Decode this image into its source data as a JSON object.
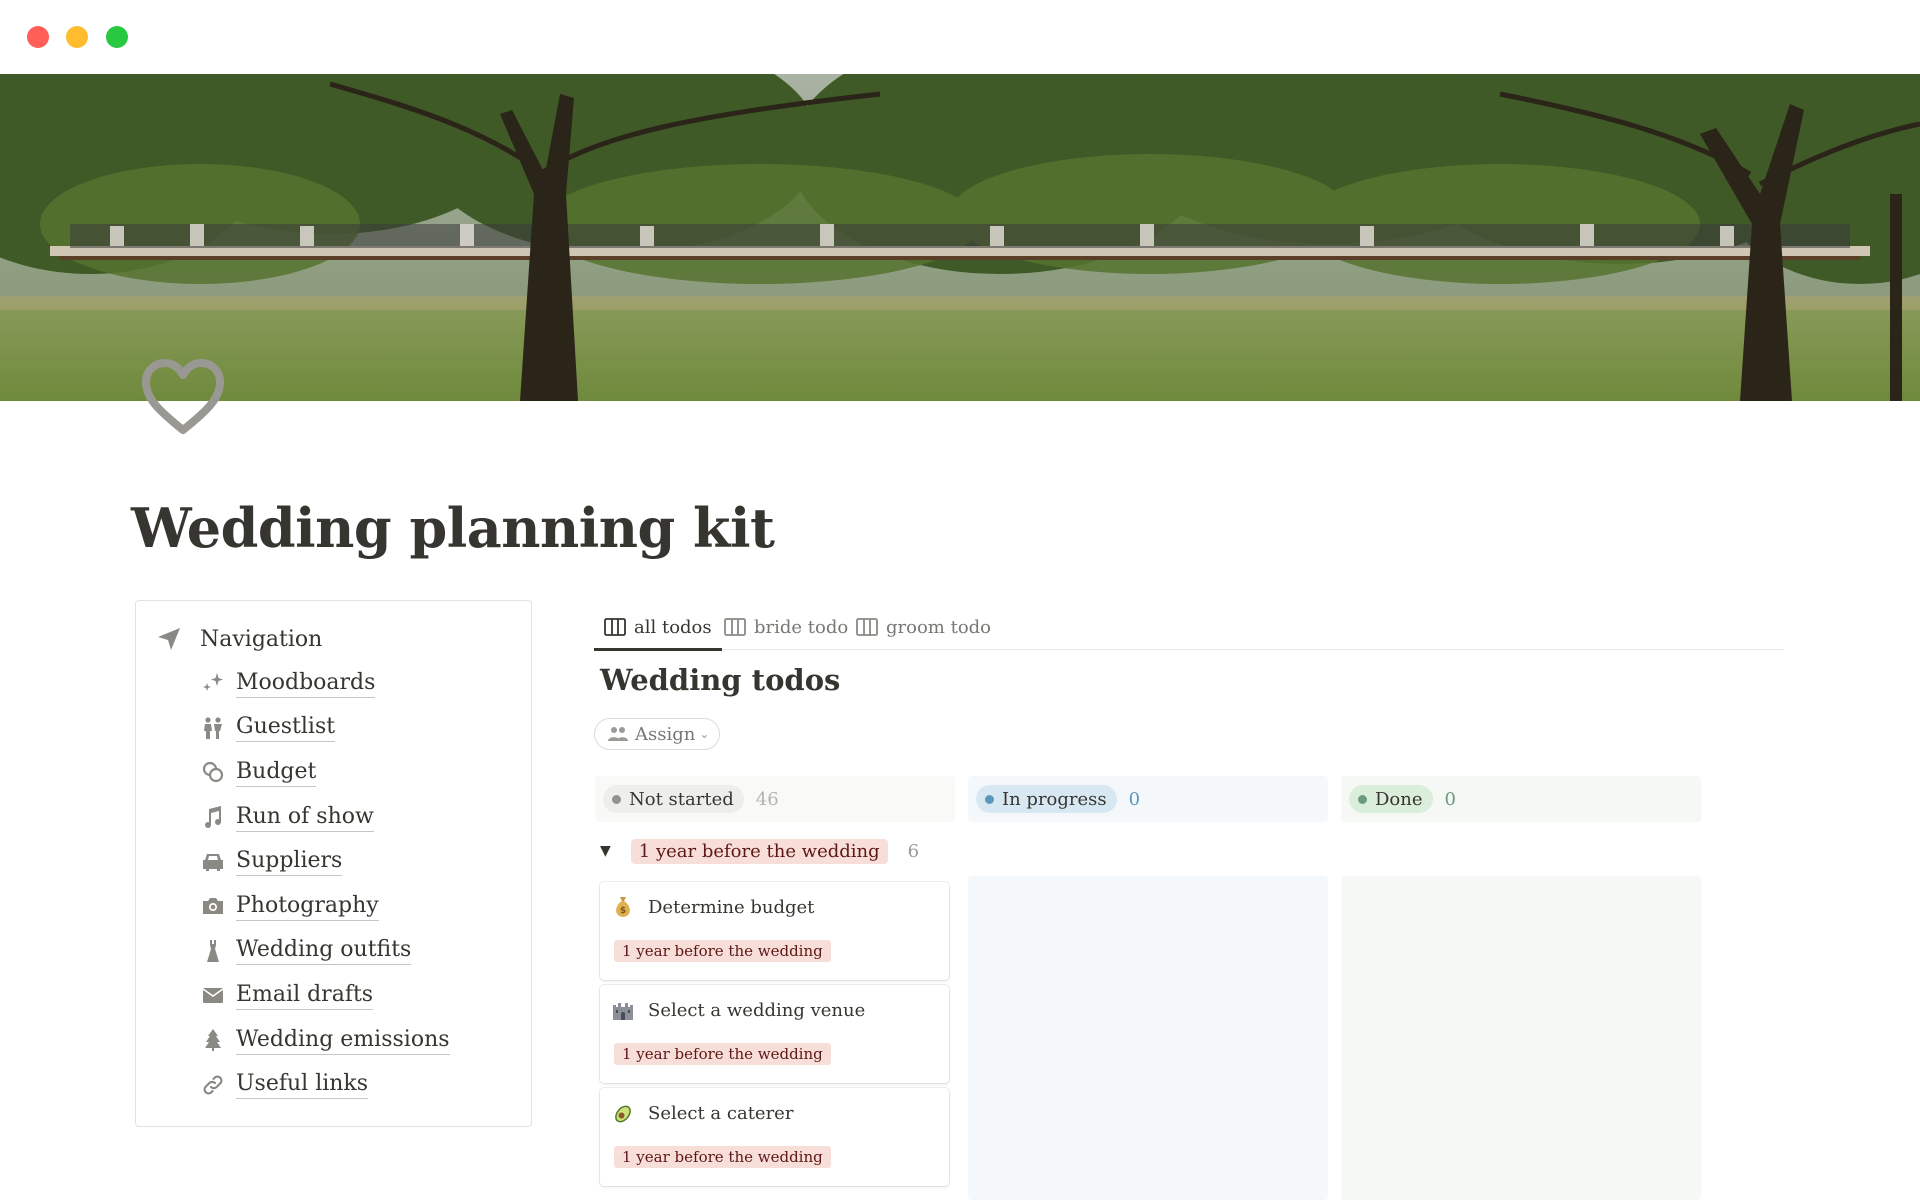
{
  "page": {
    "title": "Wedding planning kit",
    "icon": "heart-icon"
  },
  "navigation": {
    "heading": "Navigation",
    "heading_icon": "location-arrow-icon",
    "items": [
      {
        "label": "Moodboards",
        "icon": "sparkles-icon"
      },
      {
        "label": "Guestlist",
        "icon": "people-icon"
      },
      {
        "label": "Budget",
        "icon": "coins-icon"
      },
      {
        "label": "Run of show",
        "icon": "music-note-icon"
      },
      {
        "label": "Suppliers",
        "icon": "car-icon"
      },
      {
        "label": "Photography",
        "icon": "camera-icon"
      },
      {
        "label": "Wedding outfits",
        "icon": "dress-icon"
      },
      {
        "label": "Email drafts",
        "icon": "envelope-icon"
      },
      {
        "label": "Wedding emissions",
        "icon": "tree-icon"
      },
      {
        "label": "Useful links",
        "icon": "link-icon"
      }
    ]
  },
  "tabs": [
    {
      "label": "all todos",
      "active": true
    },
    {
      "label": "bride todo",
      "active": false
    },
    {
      "label": "groom todo",
      "active": false
    }
  ],
  "board": {
    "title": "Wedding todos",
    "filter_label": "Assign",
    "columns": [
      {
        "label": "Not started",
        "count": "46",
        "color": "#91918e"
      },
      {
        "label": "In progress",
        "count": "0",
        "color": "#5b97bd"
      },
      {
        "label": "Done",
        "count": "0",
        "color": "#6c9b7d"
      }
    ],
    "group": {
      "label": "1 year before the wedding",
      "count": "6"
    },
    "cards": [
      {
        "title": "Determine budget",
        "tag": "1 year before the wedding",
        "emoji": "money-bag-icon"
      },
      {
        "title": "Select a wedding venue",
        "tag": "1 year before the wedding",
        "emoji": "castle-icon"
      },
      {
        "title": "Select a caterer",
        "tag": "1 year before the wedding",
        "emoji": "avocado-icon"
      }
    ]
  },
  "colors": {
    "text": "#37352f",
    "muted": "#787774",
    "tag_bg": "#f8ded8",
    "tag_text": "#5d1715"
  }
}
